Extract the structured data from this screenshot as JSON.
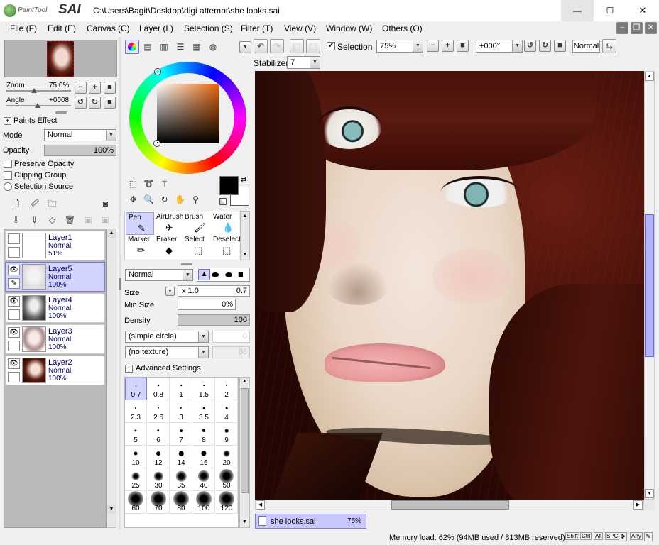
{
  "window": {
    "logo_small": "PaintTool",
    "logo_big": "SAI",
    "title": "C:\\Users\\Bagit\\Desktop\\digi attempt\\she looks.sai",
    "minimize": "—",
    "maximize": "☐",
    "close": "✕"
  },
  "menu": [
    "File (F)",
    "Edit (E)",
    "Canvas (C)",
    "Layer (L)",
    "Selection (S)",
    "Filter (T)",
    "View (V)",
    "Window (W)",
    "Others (O)"
  ],
  "navigator": {
    "zoom_label": "Zoom",
    "zoom_value": "75.0%",
    "angle_label": "Angle",
    "angle_value": "+0008"
  },
  "paints_effect": {
    "header": "Paints Effect",
    "mode_label": "Mode",
    "mode_value": "Normal",
    "opacity_label": "Opacity",
    "opacity_value": "100%",
    "preserve_opacity": "Preserve Opacity",
    "clipping_group": "Clipping Group",
    "selection_source": "Selection Source"
  },
  "layers": [
    {
      "name": "Layer1",
      "mode": "Normal",
      "opacity": "51%"
    },
    {
      "name": "Layer5",
      "mode": "Normal",
      "opacity": "100%"
    },
    {
      "name": "Layer4",
      "mode": "Normal",
      "opacity": "100%"
    },
    {
      "name": "Layer3",
      "mode": "Normal",
      "opacity": "100%"
    },
    {
      "name": "Layer2",
      "mode": "Normal",
      "opacity": "100%"
    }
  ],
  "tools": [
    {
      "label": "Pen",
      "icon": "✎"
    },
    {
      "label": "AirBrush",
      "icon": "✈"
    },
    {
      "label": "Brush",
      "icon": "🖌"
    },
    {
      "label": "Water",
      "icon": "💧"
    },
    {
      "label": "Marker",
      "icon": "✏"
    },
    {
      "label": "Eraser",
      "icon": "◆"
    },
    {
      "label": "Select",
      "icon": "⬚"
    },
    {
      "label": "Deselect",
      "icon": "⬚"
    }
  ],
  "brush": {
    "blend_mode": "Normal",
    "size_label": "Size",
    "size_mult": "x 1.0",
    "size_value": "0.7",
    "min_size_label": "Min Size",
    "min_size_value": "0%",
    "density_label": "Density",
    "density_value": "100",
    "shape": "(simple circle)",
    "shape_value": "0",
    "texture": "(no texture)",
    "texture_value": "66",
    "advanced": "Advanced Settings"
  },
  "brush_sizes": [
    "0.7",
    "0.8",
    "1",
    "1.5",
    "2",
    "2.3",
    "2.6",
    "3",
    "3.5",
    "4",
    "5",
    "6",
    "7",
    "8",
    "9",
    "10",
    "12",
    "14",
    "16",
    "20",
    "25",
    "30",
    "35",
    "40",
    "50",
    "60",
    "70",
    "80",
    "100",
    "120"
  ],
  "toolbar": {
    "selection_label": "Selection",
    "zoom_value": "75%",
    "angle_value": "+000°",
    "blend_value": "Normal",
    "stabilizer_label": "Stabilizer",
    "stabilizer_value": "7"
  },
  "tab": {
    "name": "she looks.sai",
    "zoom": "75%"
  },
  "status": {
    "memory": "Memory load: 62% (94MB used / 813MB reserved)",
    "keys": [
      "Shift",
      "Ctrl",
      "Alt",
      "SPC",
      "✥",
      "Any",
      "✎"
    ]
  },
  "colors": {
    "selected_layer": "#d3d3ff",
    "status_blue": "#c8c8ff",
    "foreground": "#000000",
    "background": "#ffffff"
  }
}
